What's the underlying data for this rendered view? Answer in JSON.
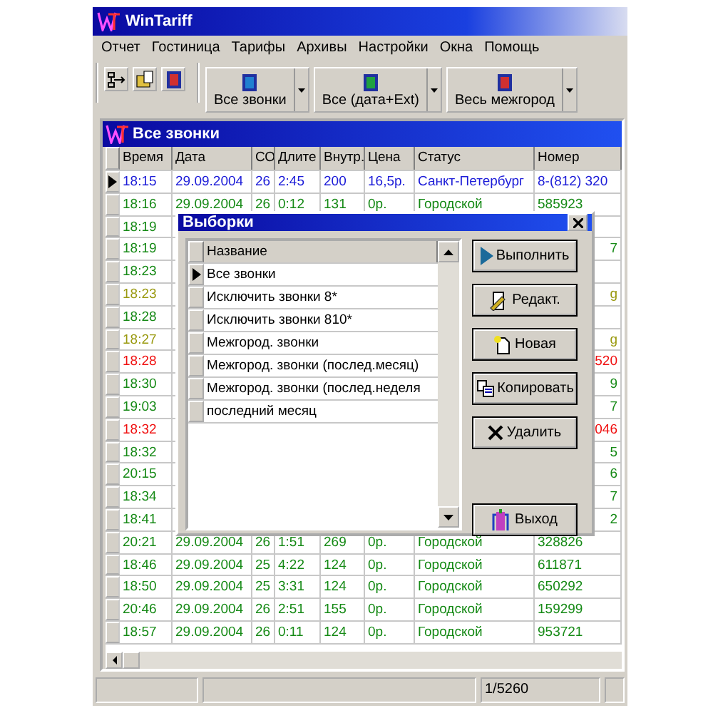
{
  "window": {
    "title": "WinTariff"
  },
  "menu": [
    "Отчет",
    "Гостиница",
    "Тарифы",
    "Архивы",
    "Настройки",
    "Окна",
    "Помощь"
  ],
  "toolbar_buttons": [
    {
      "label": "Все звонки"
    },
    {
      "label": "Все (дата+Ext)"
    },
    {
      "label": "Весь межгород"
    }
  ],
  "calls_window": {
    "title": "Все звонки",
    "columns": [
      "Время",
      "Дата",
      "СО",
      "Длите",
      "Внутр.",
      "Цена",
      "Статус",
      "Номер"
    ],
    "rows": [
      {
        "time": "18:15",
        "date": "29.09.2004",
        "co": "26",
        "duration": "2:45",
        "internal": "200",
        "price": "16,5р.",
        "status": "Санкт-Петербург",
        "number": "8-(812) 320",
        "color": "#1c1cd8",
        "selected": true
      },
      {
        "time": "18:16",
        "date": "29.09.2004",
        "co": "26",
        "duration": "0:12",
        "internal": "131",
        "price": "0р.",
        "status": "Городской",
        "number": "585923",
        "color": "#168a16",
        "selected": false
      },
      {
        "time": "18:19",
        "color": "#168a16",
        "selected": false
      },
      {
        "time": "18:19",
        "number": "7",
        "color": "#168a16",
        "selected": false
      },
      {
        "time": "18:23",
        "color": "#168a16",
        "selected": false
      },
      {
        "time": "18:23",
        "number": "g",
        "color": "#9a9a10",
        "selected": false
      },
      {
        "time": "18:28",
        "color": "#168a16",
        "selected": false
      },
      {
        "time": "18:27",
        "number": "g",
        "color": "#9a9a10",
        "selected": false
      },
      {
        "time": "18:28",
        "number": "520",
        "color": "#f01010",
        "selected": false
      },
      {
        "time": "18:30",
        "number": "9",
        "color": "#168a16",
        "selected": false
      },
      {
        "time": "19:03",
        "number": "7",
        "color": "#168a16",
        "selected": false
      },
      {
        "time": "18:32",
        "number": "046",
        "color": "#f01010",
        "selected": false
      },
      {
        "time": "18:32",
        "number": "5",
        "color": "#168a16",
        "selected": false
      },
      {
        "time": "20:15",
        "number": "6",
        "color": "#168a16",
        "selected": false
      },
      {
        "time": "18:34",
        "number": "7",
        "color": "#168a16",
        "selected": false
      },
      {
        "time": "18:41",
        "number": "2",
        "color": "#168a16",
        "selected": false
      },
      {
        "time": "20:21",
        "date": "29.09.2004",
        "co": "26",
        "duration": "1:51",
        "internal": "269",
        "price": "0р.",
        "status": "Городской",
        "number": "328826",
        "color": "#168a16",
        "selected": false
      },
      {
        "time": "18:46",
        "date": "29.09.2004",
        "co": "25",
        "duration": "4:22",
        "internal": "124",
        "price": "0р.",
        "status": "Городской",
        "number": "611871",
        "color": "#168a16",
        "selected": false
      },
      {
        "time": "18:50",
        "date": "29.09.2004",
        "co": "25",
        "duration": "3:31",
        "internal": "124",
        "price": "0р.",
        "status": "Городской",
        "number": "650292",
        "color": "#168a16",
        "selected": false
      },
      {
        "time": "20:46",
        "date": "29.09.2004",
        "co": "26",
        "duration": "2:51",
        "internal": "155",
        "price": "0р.",
        "status": "Городской",
        "number": "159299",
        "color": "#168a16",
        "selected": false
      },
      {
        "time": "18:57",
        "date": "29.09.2004",
        "co": "26",
        "duration": "0:11",
        "internal": "124",
        "price": "0р.",
        "status": "Городской",
        "number": "953721",
        "color": "#168a16",
        "selected": false
      }
    ]
  },
  "dialog": {
    "title": "Выборки",
    "list_column": "Название",
    "items": [
      {
        "label": "Все звонки",
        "selected": true
      },
      {
        "label": "Исключить звонки 8*",
        "selected": false
      },
      {
        "label": "Исключить звонки 810*",
        "selected": false
      },
      {
        "label": "Межгород. звонки",
        "selected": false
      },
      {
        "label": "Межгород. звонки (послед.месяц)",
        "selected": false
      },
      {
        "label": "Межгород. звонки (послед.неделя",
        "selected": false
      },
      {
        "label": "последний месяц",
        "selected": false
      }
    ],
    "buttons": [
      {
        "label": "Выполнить",
        "kind": "run"
      },
      {
        "label": "Редакт.",
        "kind": "edit"
      },
      {
        "label": "Новая",
        "kind": "new"
      },
      {
        "label": "Копировать",
        "kind": "copy"
      },
      {
        "label": "Удалить",
        "kind": "delete"
      },
      {
        "label": "Выход",
        "kind": "exit"
      }
    ]
  },
  "status_bar": {
    "record": "1/5260"
  }
}
